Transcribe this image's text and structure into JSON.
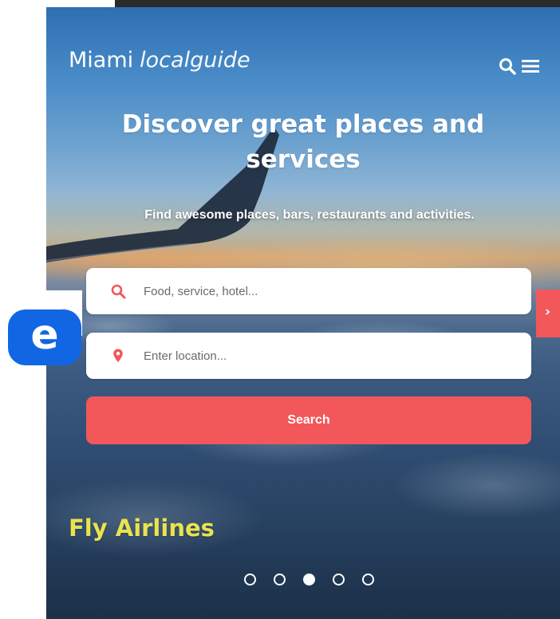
{
  "header": {
    "logo_strong": "Miami",
    "logo_light": "localguide",
    "search_icon": "search-icon",
    "menu_icon": "hamburger-menu-icon"
  },
  "hero": {
    "title": "Discover great places and services",
    "subtitle": "Find awesome places, bars, restaurants and activities."
  },
  "search_form": {
    "what_placeholder": "Food, service, hotel...",
    "what_icon": "search-icon",
    "where_placeholder": "Enter location...",
    "where_icon": "map-pin-icon",
    "button_label": "Search"
  },
  "carousel": {
    "prev_arrow": "‹",
    "next_arrow": "›",
    "slide_caption": "Fly Airlines",
    "slide_count": 5,
    "active_slide": 3
  },
  "badge": {
    "letter": "e",
    "icon": "brand-logo-icon"
  },
  "colors": {
    "accent": "#f2575a",
    "caption": "#e9e34f",
    "badge": "#1167e3",
    "top_bar": "#2a2a2a"
  }
}
